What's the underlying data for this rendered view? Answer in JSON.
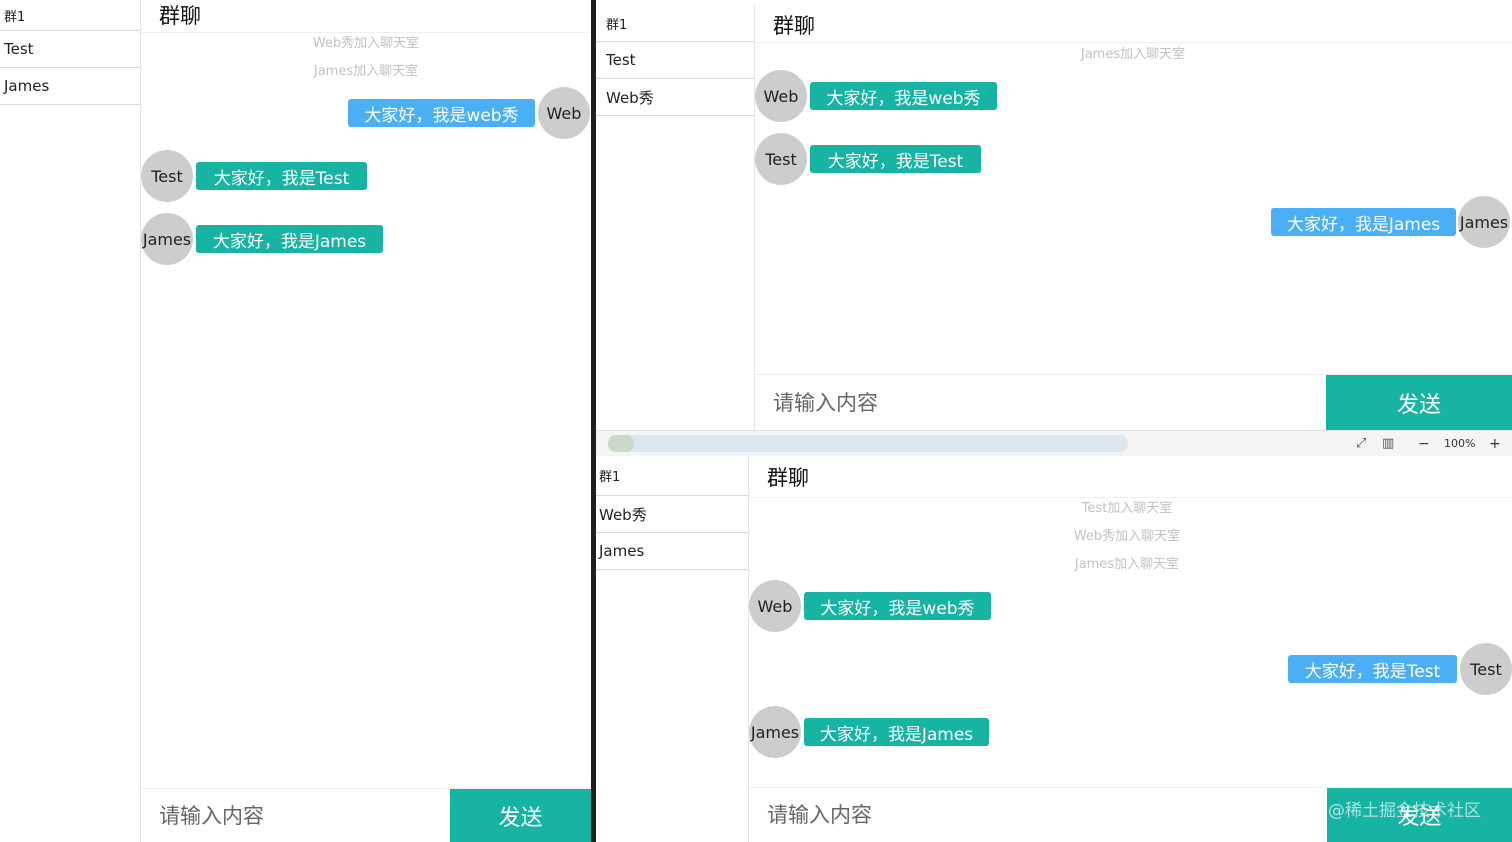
{
  "windows": [
    {
      "sidebar": {
        "group": "群1",
        "members": [
          "Test",
          "James"
        ]
      },
      "chat": {
        "title": "群聊",
        "notices": [
          "Web秀加入聊天室",
          "James加入聊天室"
        ],
        "messages": [
          {
            "avatar": "Web",
            "text": "大家好，我是web秀",
            "mine": true
          },
          {
            "avatar": "Test",
            "text": "大家好，我是Test",
            "mine": false
          },
          {
            "avatar": "James",
            "text": "大家好，我是James",
            "mine": false
          }
        ]
      },
      "input": {
        "placeholder": "请输入内容",
        "value": ""
      },
      "send_label": "发送"
    },
    {
      "sidebar": {
        "group": "群1",
        "members": [
          "Test",
          "Web秀"
        ]
      },
      "chat": {
        "title": "群聊",
        "notices": [
          "James加入聊天室"
        ],
        "messages": [
          {
            "avatar": "Web",
            "text": "大家好，我是web秀",
            "mine": false
          },
          {
            "avatar": "Test",
            "text": "大家好，我是Test",
            "mine": false
          },
          {
            "avatar": "James",
            "text": "大家好，我是James",
            "mine": true
          }
        ]
      },
      "input": {
        "placeholder": "请输入内容",
        "value": ""
      },
      "send_label": "发送"
    },
    {
      "sidebar": {
        "group": "群1",
        "members": [
          "Web秀",
          "James"
        ]
      },
      "chat": {
        "title": "群聊",
        "notices": [
          "Test加入聊天室",
          "Web秀加入聊天室",
          "James加入聊天室"
        ],
        "messages": [
          {
            "avatar": "Web",
            "text": "大家好，我是web秀",
            "mine": false
          },
          {
            "avatar": "Test",
            "text": "大家好，我是Test",
            "mine": true
          },
          {
            "avatar": "James",
            "text": "大家好，我是James",
            "mine": false
          }
        ]
      },
      "input": {
        "placeholder": "请输入内容",
        "value": ""
      },
      "send_label": "发送"
    }
  ],
  "statusbar": {
    "zoom": "100%",
    "zoom_out": "−",
    "zoom_in": "+"
  },
  "watermark": "@稀土掘金技术社区",
  "colors": {
    "bubble_other": "#17b3a3",
    "bubble_self": "#4aaff5",
    "send_button": "#17b3a3",
    "avatar": "#cdcdcd"
  }
}
